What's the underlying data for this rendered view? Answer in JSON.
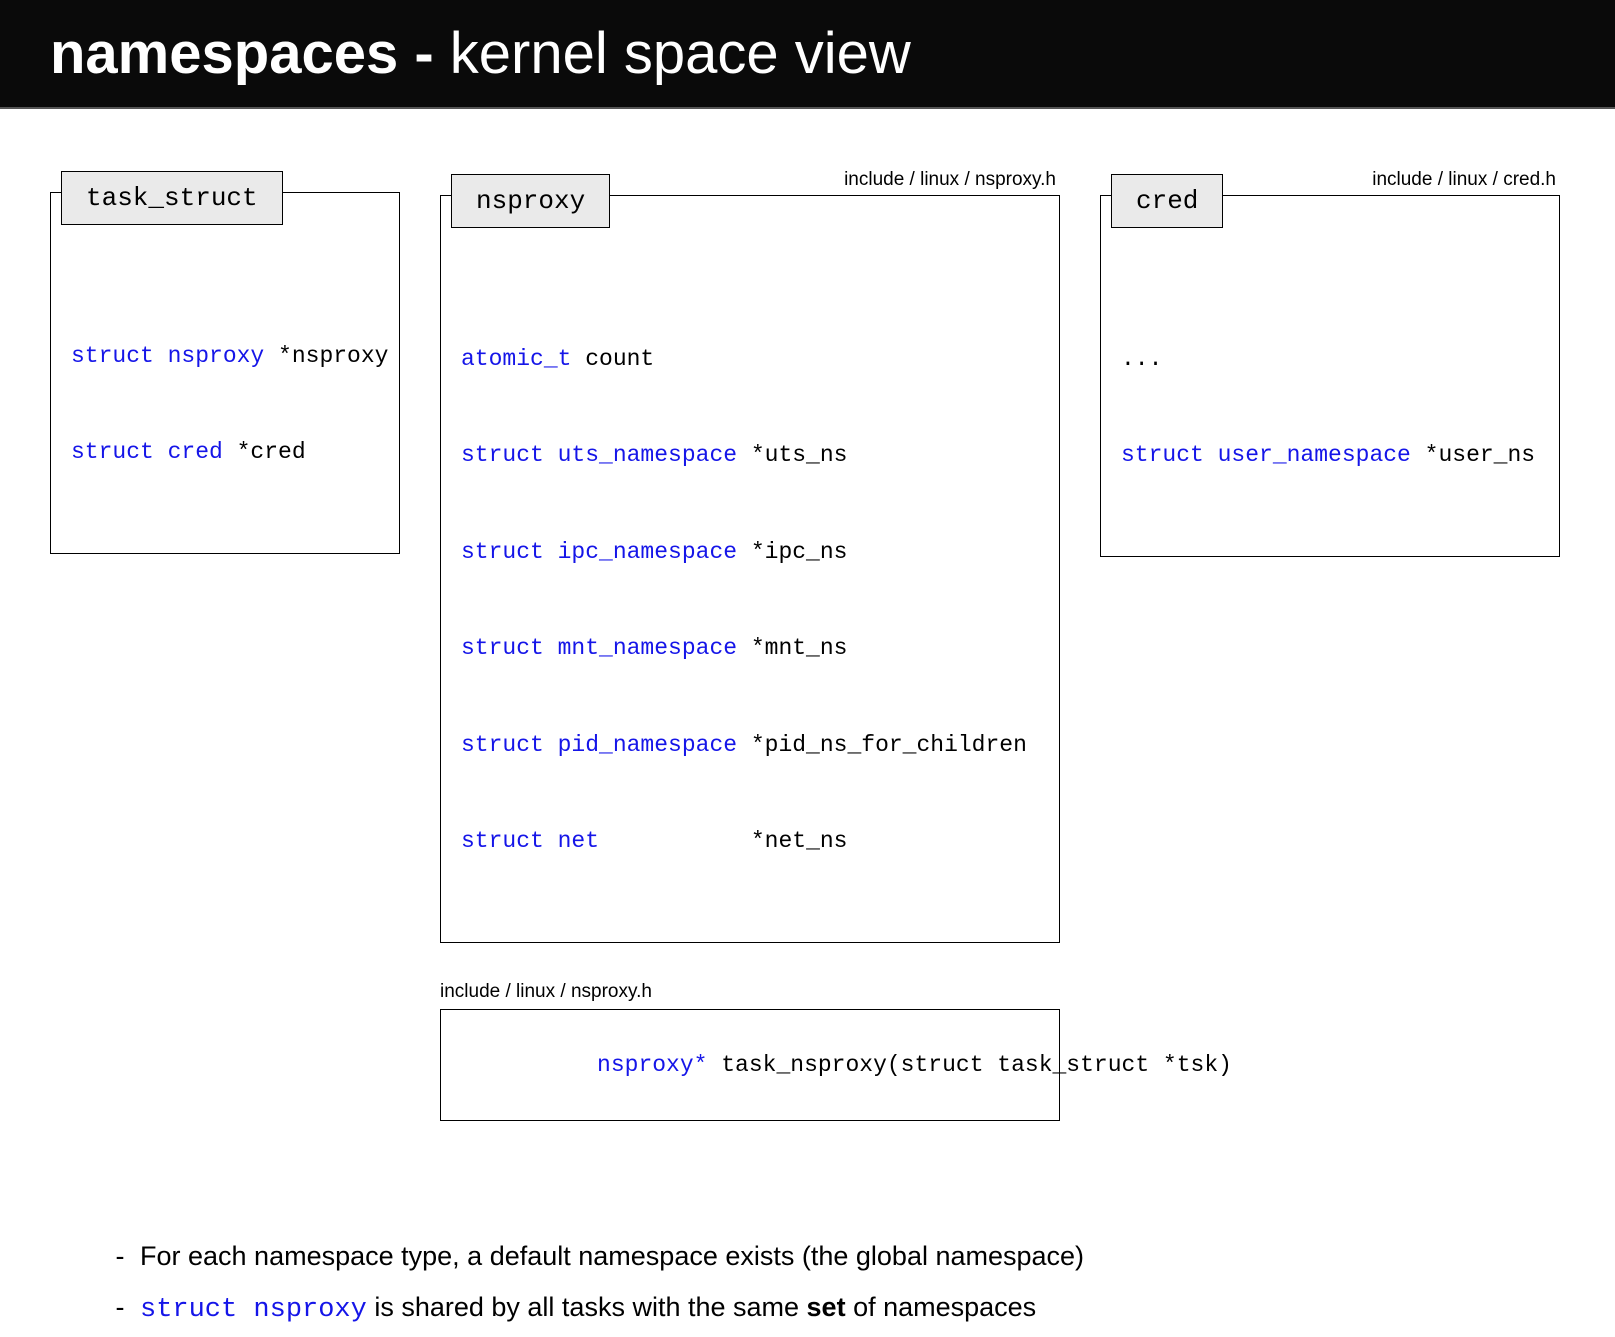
{
  "header": {
    "title_bold": "namespaces -",
    "title_normal": " kernel space view"
  },
  "structs": {
    "task": {
      "tab": "task_struct",
      "line1_kw": "struct nsproxy",
      "line1_rest": " *nsproxy",
      "line2_kw": "struct cred",
      "line2_rest": " *cred"
    },
    "nsproxy": {
      "path": "include / linux / nsproxy.h",
      "tab": "nsproxy",
      "l1_kw": "atomic_t",
      "l1_rest": " count",
      "l2_kw": "struct uts_namespace",
      "l2_rest": " *uts_ns",
      "l3_kw": "struct ipc_namespace",
      "l3_rest": " *ipc_ns",
      "l4_kw": "struct mnt_namespace",
      "l4_rest": " *mnt_ns",
      "l5_kw": "struct pid_namespace",
      "l5_rest": " *pid_ns_for_children",
      "l6_kw": "struct net",
      "l6_rest": "           *net_ns"
    },
    "cred": {
      "path": "include / linux / cred.h",
      "tab": "cred",
      "l1": "...",
      "l2_kw": "struct user_namespace",
      "l2_rest": " *user_ns"
    }
  },
  "func": {
    "path": "include / linux / nsproxy.h",
    "kw": "nsproxy*",
    "rest": " task_nsproxy(struct task_struct *tsk)"
  },
  "bullets": {
    "b1": "For each namespace type, a default namespace exists (the global namespace)",
    "b2_kw": "struct nsproxy",
    "b2_mid": " is shared by all tasks with the same ",
    "b2_bold": "set",
    "b2_end": " of namespaces"
  }
}
